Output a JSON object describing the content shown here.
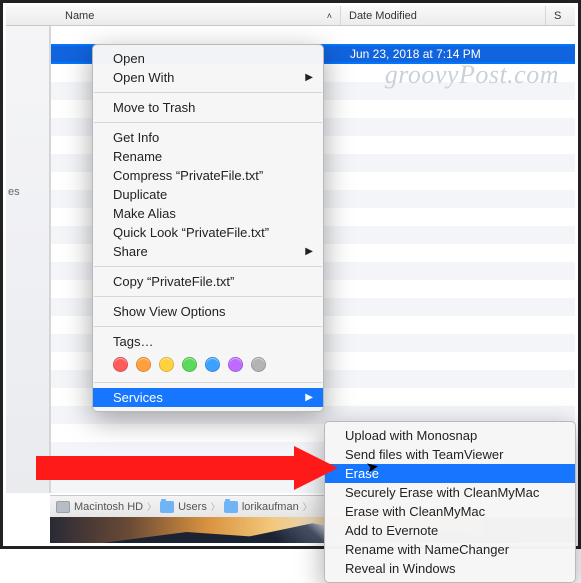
{
  "header": {
    "col_name": "Name",
    "col_date": "Date Modified",
    "col_s": "S"
  },
  "file": {
    "date": "Jun 23, 2018 at 7:14 PM"
  },
  "sidebar_fragment": "es",
  "watermark": "groovyPost.com",
  "pathbar": {
    "hd": "Macintosh HD",
    "users": "Users",
    "user": "lorikaufman",
    "more": "…"
  },
  "ctx1": {
    "open": "Open",
    "open_with": "Open With",
    "trash": "Move to Trash",
    "get_info": "Get Info",
    "rename": "Rename",
    "compress": "Compress “PrivateFile.txt”",
    "duplicate": "Duplicate",
    "make_alias": "Make Alias",
    "quick_look": "Quick Look “PrivateFile.txt”",
    "share": "Share",
    "copy": "Copy “PrivateFile.txt”",
    "show_view_options": "Show View Options",
    "tags": "Tags…",
    "services": "Services"
  },
  "tag_colors": [
    "#ff5b5b",
    "#ff9f3d",
    "#ffd23d",
    "#5bd95b",
    "#3da1ff",
    "#c06bff",
    "#b3b3b3"
  ],
  "ctx2": {
    "monosnap": "Upload with Monosnap",
    "teamviewer": "Send files with TeamViewer",
    "erase": "Erase",
    "sec_erase": "Securely Erase with CleanMyMac",
    "erase_cmm": "Erase with CleanMyMac",
    "evernote": "Add to Evernote",
    "namechanger": "Rename with NameChanger",
    "reveal": "Reveal in Windows"
  }
}
